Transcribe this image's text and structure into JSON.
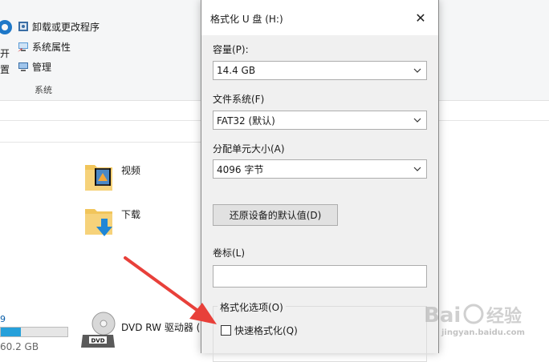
{
  "ribbon": {
    "partial_left_label_1": "开",
    "partial_left_label_2": "置",
    "items": [
      {
        "label": "卸载或更改程序",
        "icon": "uninstall-icon"
      },
      {
        "label": "系统属性",
        "icon": "system-properties-icon"
      },
      {
        "label": "管理",
        "icon": "manage-icon"
      }
    ],
    "group_label": "系统"
  },
  "folders": [
    {
      "label": "视频",
      "icon": "videos-folder-icon"
    },
    {
      "label": "下载",
      "icon": "downloads-folder-icon"
    }
  ],
  "drives": {
    "dvd_label": "DVD RW 驱动器 (",
    "partial_size": "60.2 GB",
    "partial_top": "9",
    "fill_fraction": 0.3
  },
  "dialog": {
    "title": "格式化 U 盘 (H:)",
    "close_glyph": "✕",
    "capacity_label": "容量(P):",
    "capacity_value": "14.4 GB",
    "filesystem_label": "文件系统(F)",
    "filesystem_value": "FAT32 (默认)",
    "allocation_label": "分配单元大小(A)",
    "allocation_value": "4096 字节",
    "restore_button": "还原设备的默认值(D)",
    "volume_label": "卷标(L)",
    "volume_value": "",
    "options_label": "格式化选项(O)",
    "quick_format_label": "快速格式化(Q)",
    "quick_format_checked": false
  },
  "watermark": {
    "brand": "Bai经验",
    "sub": "jingyan.baidu.com"
  },
  "colors": {
    "accent": "#26a0da",
    "arrow": "#e8403a"
  }
}
